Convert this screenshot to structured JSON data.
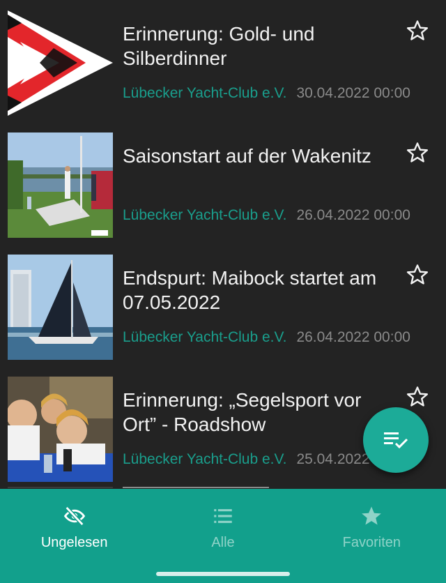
{
  "items": [
    {
      "title": "Erinnerung: Gold- und Silberdinner",
      "source": "Lübecker Yacht-Club e.V.",
      "date": "30.04.2022 00:00",
      "thumb": "club-burgee-image"
    },
    {
      "title": "Saisonstart auf der Wakenitz",
      "source": "Lübecker Yacht-Club e.V.",
      "date": "26.04.2022 00:00",
      "thumb": "lakeside-boat-prep-photo"
    },
    {
      "title": "Endspurt: Maibock startet am 07.05.2022",
      "source": "Lübecker Yacht-Club e.V.",
      "date": "26.04.2022 00:00",
      "thumb": "sailboat-race-photo"
    },
    {
      "title": "Erinnerung: „Segelsport vor Ort” - Roadshow",
      "source": "Lübecker Yacht-Club e.V.",
      "date": "25.04.2022 00:00",
      "thumb": "children-experiment-photo"
    }
  ],
  "fab": {
    "icon": "mark-all-read-icon"
  },
  "nav": {
    "items": [
      {
        "label": "Ungelesen",
        "icon": "eye-off-icon",
        "active": true
      },
      {
        "label": "Alle",
        "icon": "list-icon",
        "active": false
      },
      {
        "label": "Favoriten",
        "icon": "star-filled-icon",
        "active": false
      }
    ]
  },
  "colors": {
    "background": "#232323",
    "accent": "#12a08c",
    "fab": "#1cab98",
    "source_text": "#1a9e8c",
    "date_text": "#8a8a8a"
  }
}
